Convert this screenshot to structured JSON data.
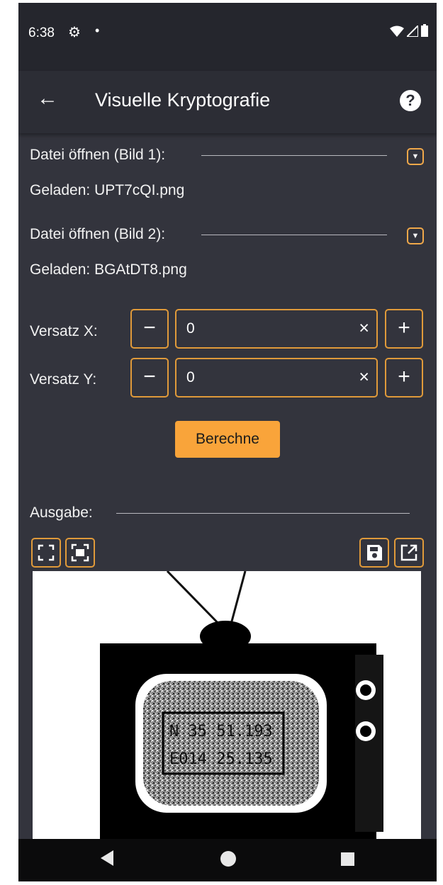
{
  "status": {
    "time": "6:38"
  },
  "app": {
    "title": "Visuelle Kryptografie"
  },
  "file1": {
    "label": "Datei öffnen (Bild 1):",
    "loaded": "Geladen: UPT7cQI.png"
  },
  "file2": {
    "label": "Datei öffnen (Bild 2):",
    "loaded": "Geladen: BGAtDT8.png"
  },
  "offset_x": {
    "label": "Versatz X:",
    "value": "0"
  },
  "offset_y": {
    "label": "Versatz Y:",
    "value": "0"
  },
  "calculate_label": "Berechne",
  "output": {
    "label": "Ausgabe:",
    "image_text_line1": "N 35 51.193",
    "image_text_line2": "E014 25.135"
  },
  "colors": {
    "accent": "#f9a43a",
    "border": "#e09a3a",
    "background": "#33343d",
    "appbar": "#2c2d35"
  },
  "icons": [
    "settings-icon",
    "wifi-icon",
    "signal-icon",
    "battery-icon",
    "back-arrow-icon",
    "help-icon",
    "dropdown-icon",
    "minus-icon",
    "plus-icon",
    "clear-icon",
    "fullscreen-icon",
    "fit-screen-icon",
    "save-icon",
    "open-external-icon"
  ]
}
